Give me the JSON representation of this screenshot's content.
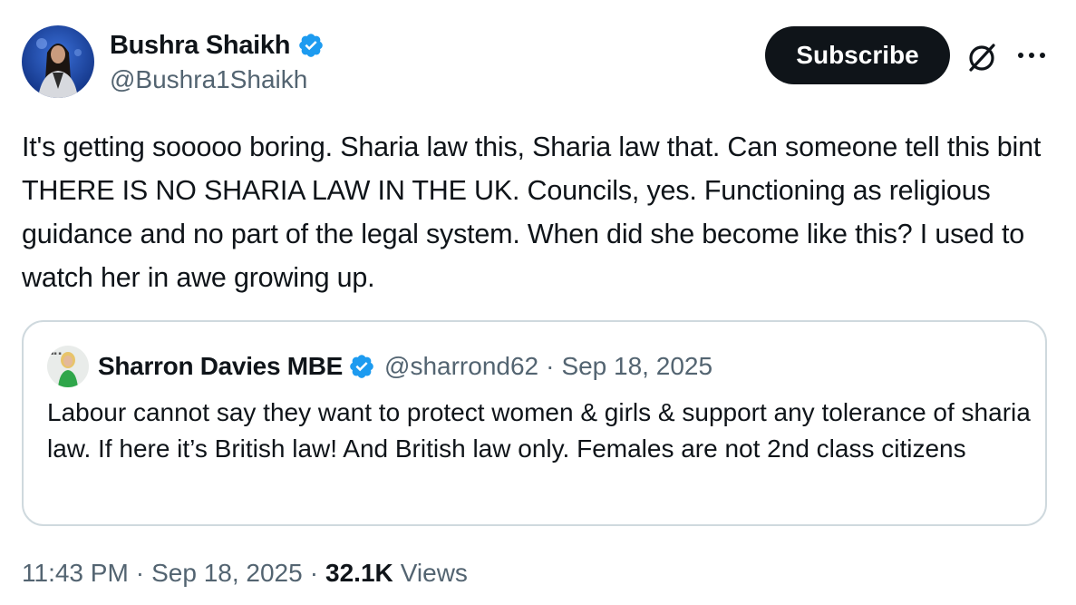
{
  "author": {
    "display_name": "Bushra Shaikh",
    "handle": "@Bushra1Shaikh",
    "verified": true
  },
  "actions": {
    "subscribe_label": "Subscribe",
    "grok_icon": "grok-icon",
    "more_icon": "more-icon"
  },
  "tweet": {
    "text": "It's getting sooooo boring. Sharia law this, Sharia law that. Can someone tell this bint THERE IS NO SHARIA LAW IN THE UK. Councils, yes. Functioning as religious guidance and no part of the legal system. When did she become like this? I used to watch her in awe growing up."
  },
  "quoted_tweet": {
    "display_name": "Sharron Davies MBE",
    "handle": "@sharrond62",
    "date": "Sep 18, 2025",
    "separator": "·",
    "verified": true,
    "text": "Labour cannot say they want to protect women & girls & support any tolerance of sharia law. If here it’s British law! And British law only. Females are not 2nd class citizens"
  },
  "footer": {
    "time": "11:43 PM",
    "date": "Sep 18, 2025",
    "views_count": "32.1K",
    "views_label": "Views",
    "separator": "·"
  },
  "colors": {
    "text_primary": "#0f1419",
    "text_secondary": "#536471",
    "verified_blue": "#1d9bf0",
    "border": "#cfd9de",
    "button_bg": "#0f1419"
  }
}
